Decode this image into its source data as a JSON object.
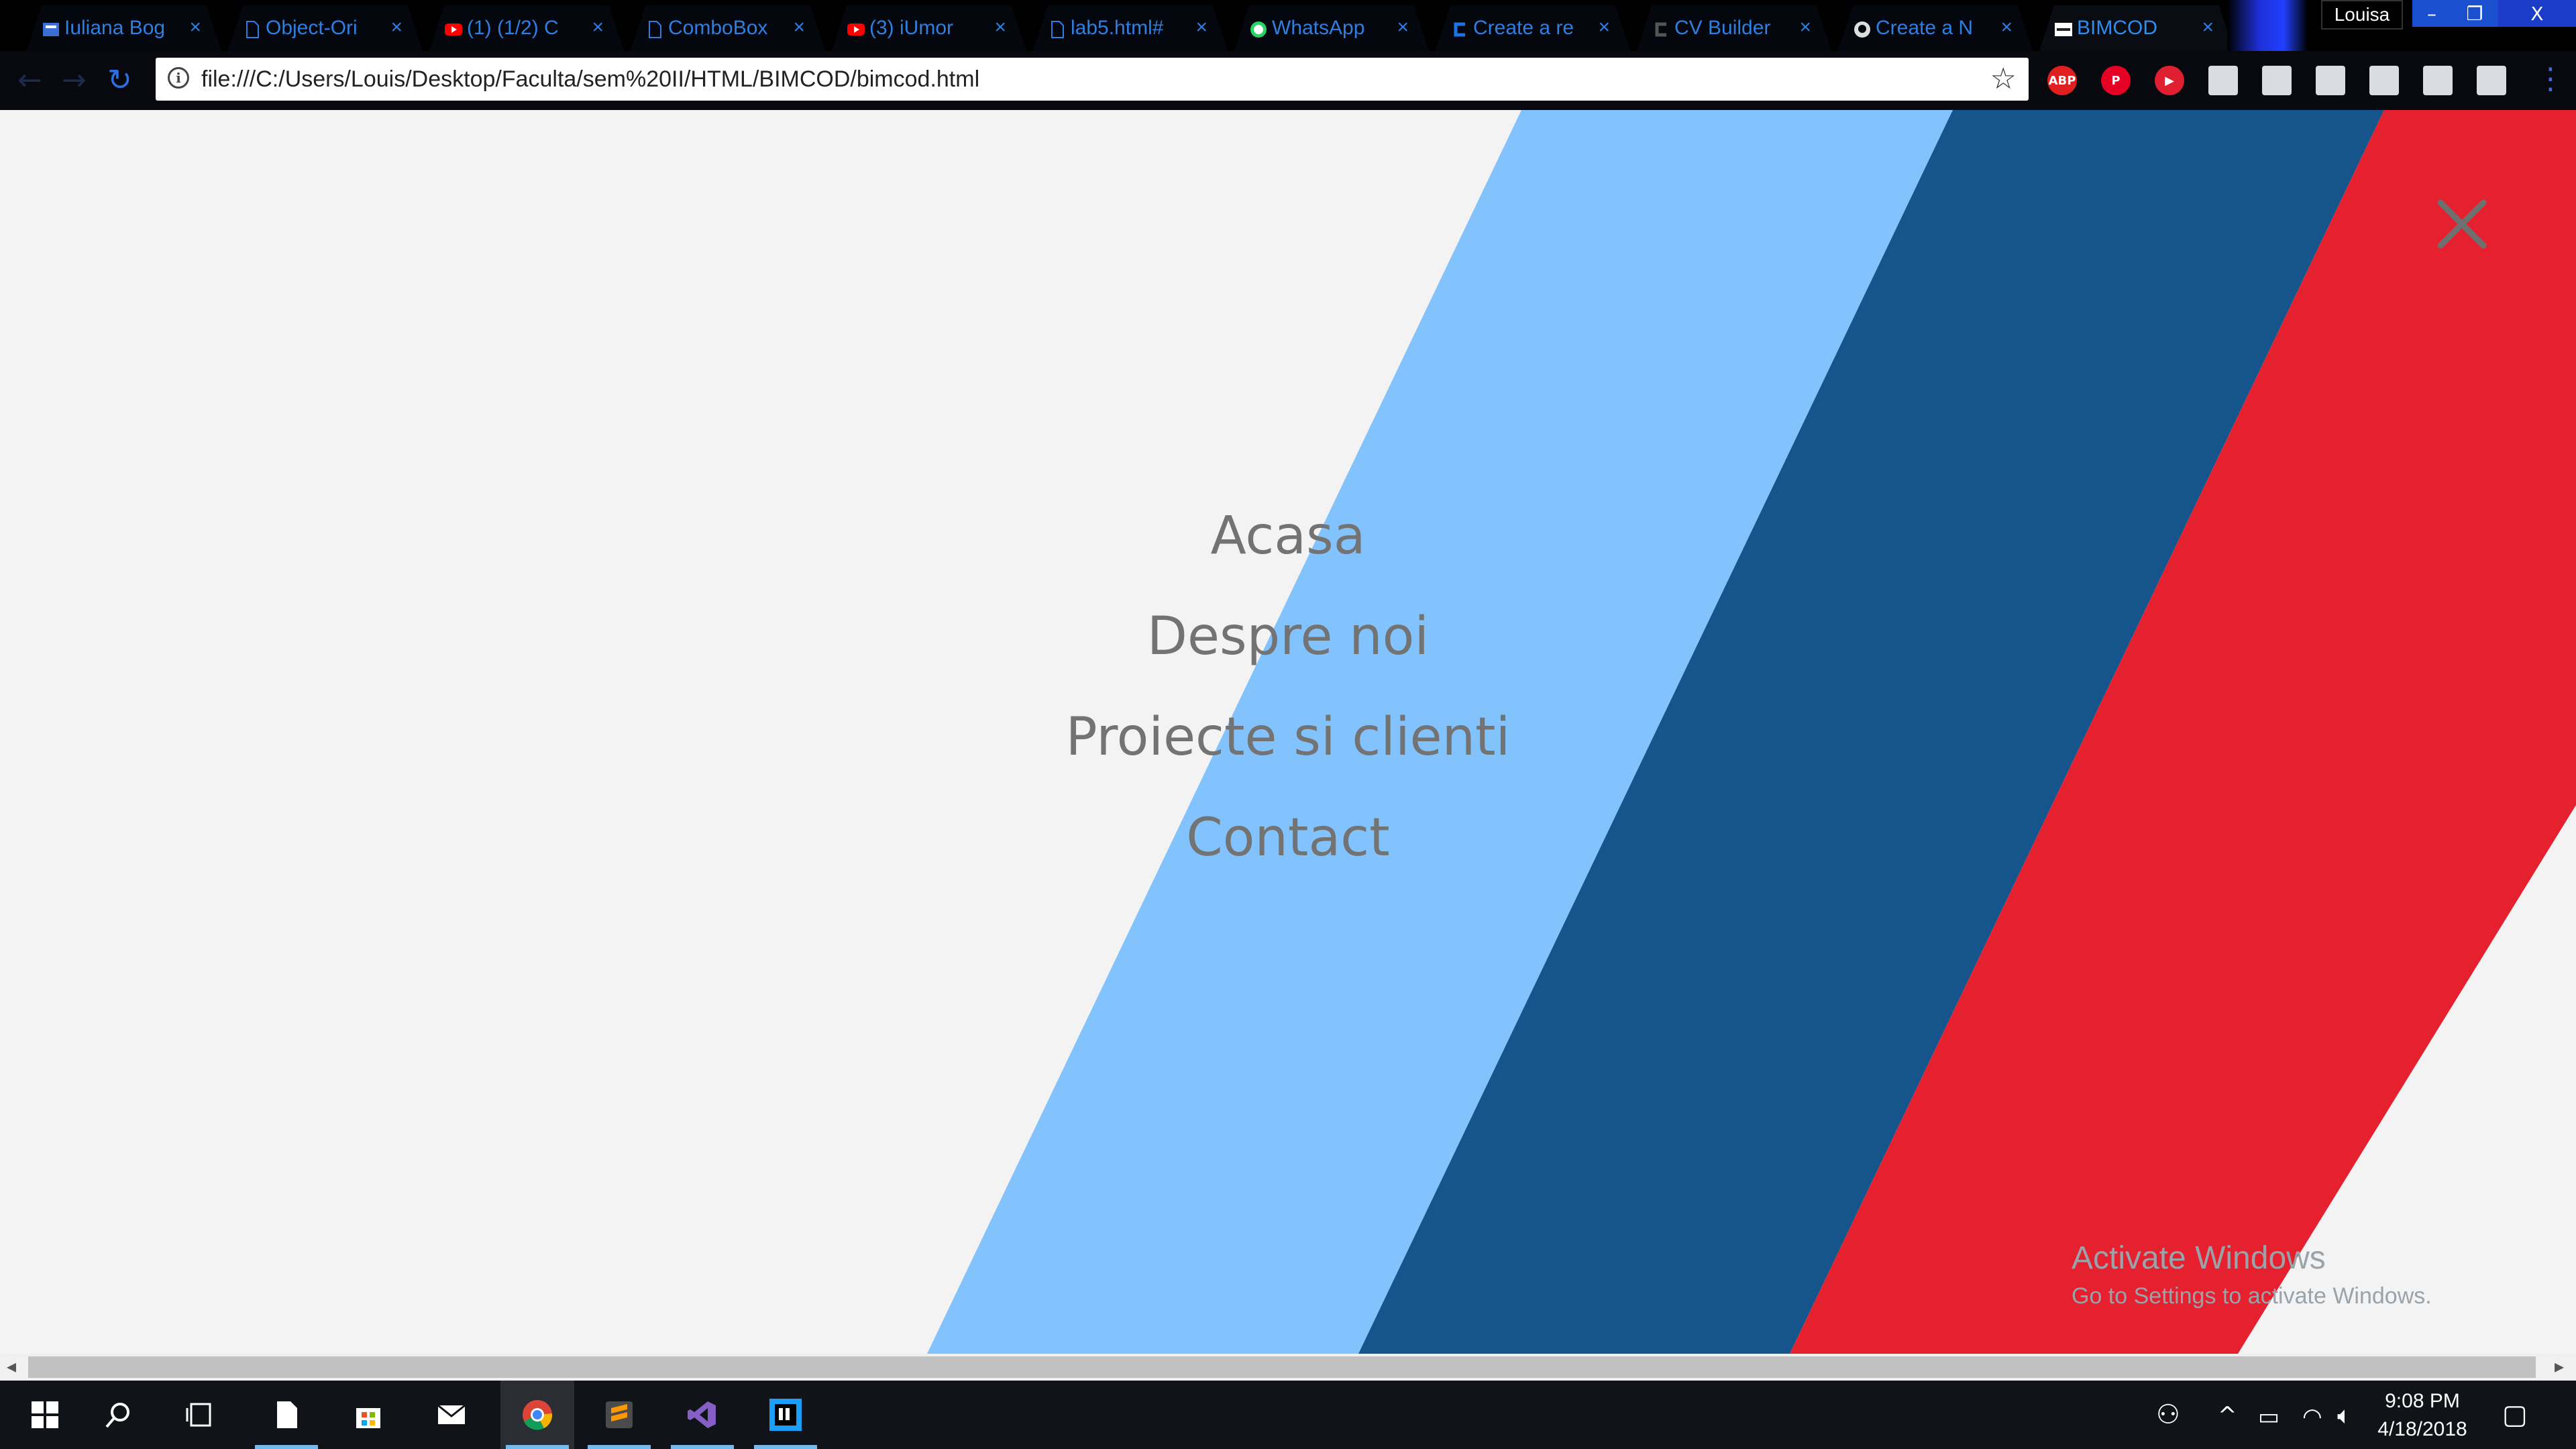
{
  "browser": {
    "tabs": [
      {
        "title": "Iuliana Bog",
        "favicon": "page-icon",
        "favicon_color": "#3b6fd6"
      },
      {
        "title": "Object-Ori",
        "favicon": "document-icon",
        "favicon_color": "#2f7fe0"
      },
      {
        "title": "(1) (1/2) C",
        "favicon": "youtube-icon",
        "favicon_color": "#ff0000"
      },
      {
        "title": "ComboBox",
        "favicon": "document-icon",
        "favicon_color": "#2f7fe0"
      },
      {
        "title": "(3) iUmor",
        "favicon": "youtube-icon",
        "favicon_color": "#ff0000"
      },
      {
        "title": "lab5.html#",
        "favicon": "document-icon",
        "favicon_color": "#2f7fe0"
      },
      {
        "title": "WhatsApp",
        "favicon": "whatsapp-icon",
        "favicon_color": "#25d366"
      },
      {
        "title": "Create a re",
        "favicon": "c-logo-icon",
        "favicon_color": "#1a73e8"
      },
      {
        "title": "CV Builder",
        "favicon": "c-logo-icon",
        "favicon_color": "#555555"
      },
      {
        "title": "Create a N",
        "favicon": "github-icon",
        "favicon_color": "#dddddd"
      },
      {
        "title": "BIMCOD",
        "favicon": "bimcod-icon",
        "favicon_color": "#ffffff",
        "active": true
      }
    ],
    "profile_name": "Louisa",
    "window_controls": {
      "minimize": "–",
      "maximize": "❐",
      "close": "X"
    },
    "address_bar": {
      "url": "file:///C:/Users/Louis/Desktop/Faculta/sem%20II/HTML/BIMCOD/bimcod.html"
    },
    "extensions": [
      {
        "name": "adblock-icon",
        "label": "ABP",
        "color": "#e02020"
      },
      {
        "name": "pinterest-icon",
        "label": "P",
        "color": "#e60023"
      },
      {
        "name": "media-icon",
        "label": "▶",
        "color": "#e02030"
      },
      {
        "name": "extension-1-icon",
        "label": "",
        "color": "#d9dde3"
      },
      {
        "name": "extension-2-icon",
        "label": "",
        "color": "#d9dde3"
      },
      {
        "name": "extension-3-icon",
        "label": "",
        "color": "#d9dde3"
      },
      {
        "name": "extension-4-icon",
        "label": "",
        "color": "#d9dde3"
      },
      {
        "name": "extension-5-icon",
        "label": "",
        "color": "#d9dde3"
      },
      {
        "name": "extension-6-icon",
        "label": "",
        "color": "#d9dde3"
      }
    ]
  },
  "page": {
    "background": "#f3f3f3",
    "stripe_colors": [
      "#83c3fd",
      "#16558b",
      "#e5202f"
    ],
    "close_icon": "close-icon",
    "menu": [
      {
        "label": "Acasa"
      },
      {
        "label": "Despre noi"
      },
      {
        "label": "Proiecte si clienti"
      },
      {
        "label": "Contact"
      }
    ],
    "activate_windows": {
      "title": "Activate Windows",
      "subtitle": "Go to Settings to activate Windows."
    }
  },
  "taskbar": {
    "apps": [
      {
        "name": "start-icon"
      },
      {
        "name": "search-icon"
      },
      {
        "name": "task-view-icon"
      },
      {
        "name": "notepad-icon",
        "running": true
      },
      {
        "name": "store-icon"
      },
      {
        "name": "mail-icon"
      },
      {
        "name": "chrome-icon",
        "running": true,
        "active": true
      },
      {
        "name": "sublime-icon",
        "running": true
      },
      {
        "name": "visual-studio-icon",
        "running": true
      },
      {
        "name": "intellij-icon",
        "running": true
      }
    ],
    "clock": {
      "time": "9:08 PM",
      "date": "4/18/2018"
    }
  }
}
